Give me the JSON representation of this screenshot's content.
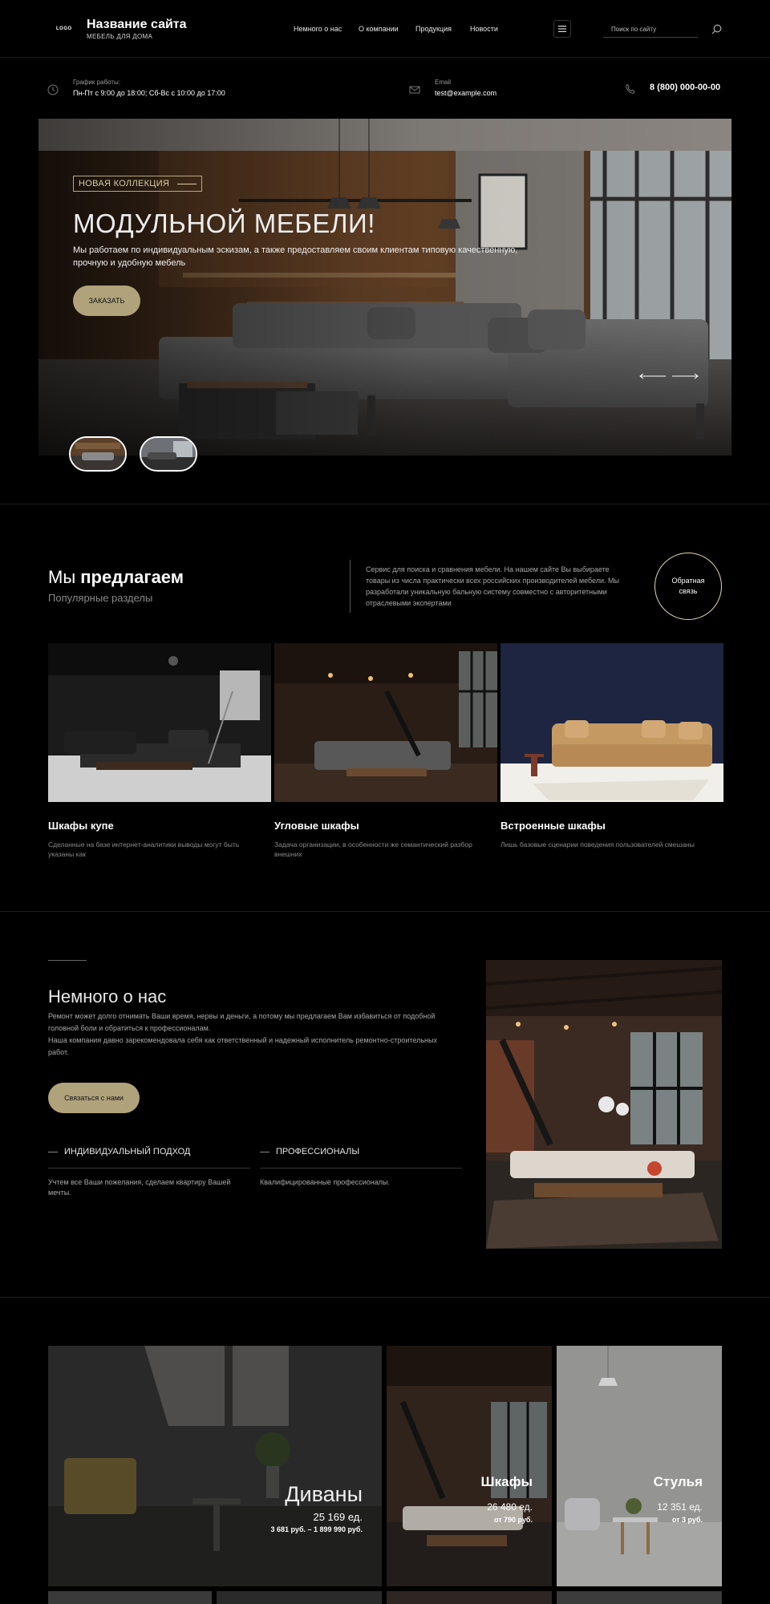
{
  "header": {
    "logo": "LOGO",
    "site_title": "Название сайта",
    "site_subtitle": "МЕБЕЛЬ ДЛЯ ДОМА",
    "nav": [
      "Немного о нас",
      "О компании",
      "Продукция",
      "Новости"
    ],
    "search_placeholder": "Поиск по сайту"
  },
  "contacts": {
    "schedule_label": "График работы:",
    "schedule_value": "Пн-Пт с 9:00 до 18:00; Сб-Вс с 10:00 до 17:00",
    "email_label": "Email",
    "email_value": "test@example.com",
    "phone": "8 (800) 000-00-00"
  },
  "hero": {
    "badge": "НОВАЯ КОЛЛЕКЦИЯ",
    "title": "МОДУЛЬНОЙ МЕБЕЛИ!",
    "text": "Мы работаем по индивидуальным эскизам, а также предоставляем своим клиентам типовую качественную, прочную и удобную мебель",
    "button": "ЗАКАЗАТЬ"
  },
  "offer": {
    "title_light": "Мы ",
    "title_bold": "предлагаем",
    "subtitle": "Популярные разделы",
    "text": "Сервис для поиска и сравнения мебели. На нашем сайте Вы выбираете товары из числа практически всех российских производителей мебели. Мы разработали уникальную бальную систему совместно с авторитетными отраслевыми экспертами",
    "feedback_line1": "Обратная",
    "feedback_line2": "связь",
    "cards": [
      {
        "title": "Шкафы купе",
        "text": "Сделанные на базе интернет-аналитики выводы могут быть указаны как"
      },
      {
        "title": "Угловые шкафы",
        "text": "Задача организации, в особенности же семантический разбор внешних"
      },
      {
        "title": "Встроенные шкафы",
        "text": "Лишь базовые сценарии поведения пользователей смешаны"
      }
    ]
  },
  "about": {
    "title": "Немного о нас",
    "text": "Ремонт может долго отнимать Ваши время, нервы и деньги, а потому мы предлагаем Вам избавиться от подобной головной боли и обратиться к профессионалам.\nНаша компания давно зарекомендовала себя как ответственный и надежный исполнитель ремонтно-строительных работ.",
    "button": "Связаться с нами",
    "features": [
      {
        "title": "ИНДИВИДУАЛЬНЫЙ ПОДХОД",
        "text": "Учтем все Ваши пожелания, сделаем квартиру Вашей мечты."
      },
      {
        "title": "ПРОФЕССИОНАЛЫ",
        "text": "Квалифицированные профессионалы."
      }
    ]
  },
  "categories": [
    {
      "name": "Диваны",
      "count": "25 169 ед.",
      "price": "3 681 руб. – 1 899 990 руб."
    },
    {
      "name": "Шкафы",
      "count": "26 480 ед.",
      "price": "от 790 руб."
    },
    {
      "name": "Стулья",
      "count": "12 351 ед.",
      "price": "от 3 руб."
    }
  ],
  "colors": {
    "accent": "#b0a27a",
    "background": "#000000"
  }
}
